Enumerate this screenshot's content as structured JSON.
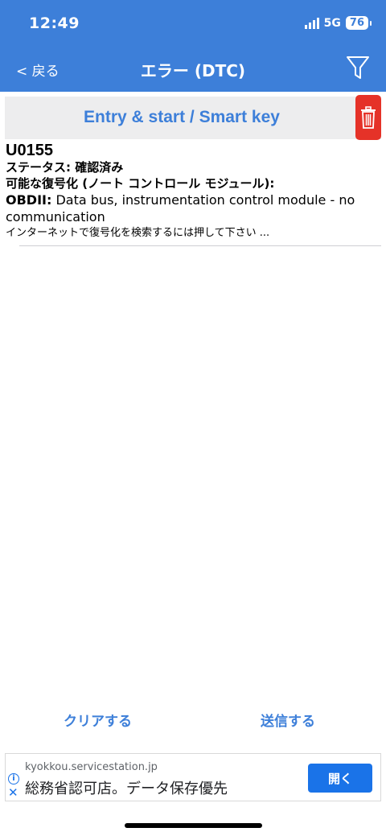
{
  "status_bar": {
    "time": "12:49",
    "network": "5G",
    "battery": "76"
  },
  "nav": {
    "back_label": "< 戻る",
    "title": "エラー (DTC)",
    "filter_icon": "filter-icon"
  },
  "module": {
    "title": "Entry & start / Smart key",
    "delete_icon": "trash-icon"
  },
  "dtc": {
    "code": "U0155",
    "status": "ステータス: 確認済み",
    "possible_label": "可能な復号化 (ノート コントロール モジュール):",
    "obd_prefix": "OBDII:",
    "obd_text": " Data bus, instrumentation control module - no communication",
    "search_hint": "インターネットで復号化を検索するには押して下さい ..."
  },
  "actions": {
    "clear_label": "クリアする",
    "send_label": "送信する"
  },
  "ad": {
    "domain": "kyokkou.servicestation.jp",
    "text": "総務省認可店。データ保存優先",
    "open_label": "開く"
  },
  "colors": {
    "accent": "#3d7fd9",
    "delete": "#e53228",
    "ad_button": "#1a73e8"
  }
}
